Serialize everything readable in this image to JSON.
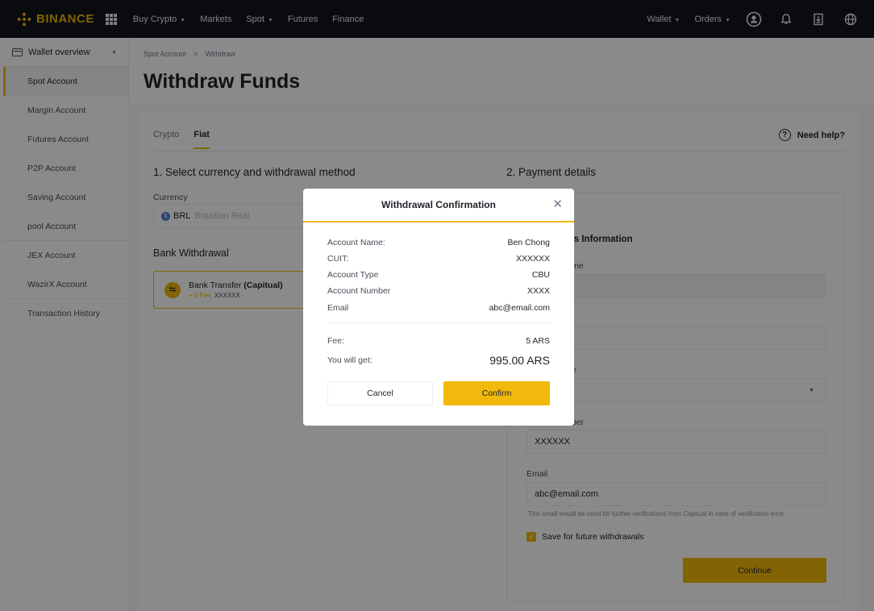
{
  "colors": {
    "accent": "#F0B90B",
    "nav_bg": "#12161C",
    "overlay": "rgba(0,0,0,0.46)"
  },
  "nav": {
    "logo": "BINANCE",
    "links": [
      {
        "label": "Buy Crypto",
        "has_caret": true
      },
      {
        "label": "Markets",
        "has_caret": false
      },
      {
        "label": "Spot",
        "has_caret": true
      },
      {
        "label": "Futures",
        "has_caret": false
      },
      {
        "label": "Finance",
        "has_caret": false
      }
    ],
    "wallet": "Wallet",
    "orders": "Orders",
    "icons": [
      "grid-icon",
      "user-icon",
      "bell-icon",
      "download-icon",
      "globe-icon"
    ]
  },
  "sidebar": {
    "header": "Wallet overview",
    "items": [
      {
        "label": "Spot Account",
        "active": true
      },
      {
        "label": "Margin Account",
        "active": false
      },
      {
        "label": "Futures Account",
        "active": false
      },
      {
        "label": "P2P Account",
        "active": false
      },
      {
        "label": "Saving Account",
        "active": false
      },
      {
        "label": "pool Account",
        "active": false
      },
      {
        "label": "JEX Account",
        "active": false
      },
      {
        "label": "WazirX Account",
        "active": false
      },
      {
        "label": "Transaction History",
        "active": false
      }
    ]
  },
  "breadcrumb": {
    "parent": "Spot Account",
    "sep": ">",
    "current": "Withdraw"
  },
  "page_title": "Withdraw Funds",
  "tabs": [
    {
      "label": "Crypto",
      "active": false
    },
    {
      "label": "Fiat",
      "active": true
    }
  ],
  "help": "Need help?",
  "left": {
    "section_title": "1. Select currency and withdrawal method",
    "currency_label": "Currency",
    "currency_code": "BRL",
    "currency_name": "Brazilian Real",
    "bank_title": "Bank Withdrawal",
    "method_name": "Bank Transfer",
    "method_provider": "(Capitual)",
    "method_fee": "+ 0 Fee,",
    "method_sub": "XXXXXX"
  },
  "right": {
    "section_title": "2. Payment details",
    "info_title_partial": "’s Information",
    "name_label_partial": "me",
    "type_label_partial": "e",
    "number_label_partial": "ber",
    "number_value": "XXXXXX",
    "email_label": "Email",
    "email_value": "abc@email.com",
    "email_hint": "This email would be used for further verifications from Capitual in case of verification error.",
    "save_label": "Save for future withdrawals",
    "continue": "Continue"
  },
  "modal": {
    "title": "Withdrawal Confirmation",
    "rows": [
      {
        "label": "Account Name:",
        "value": "Ben Chong"
      },
      {
        "label": "CUIT:",
        "value": "XXXXXX"
      },
      {
        "label": "Account Type",
        "value": "CBU"
      },
      {
        "label": "Account Number",
        "value": "XXXX"
      },
      {
        "label": "Email",
        "value": "abc@email.com"
      }
    ],
    "fee_label": "Fee:",
    "fee_value": "5 ARS",
    "get_label": "You will get:",
    "get_value": "995.00 ARS",
    "cancel": "Cancel",
    "confirm": "Confirm"
  }
}
